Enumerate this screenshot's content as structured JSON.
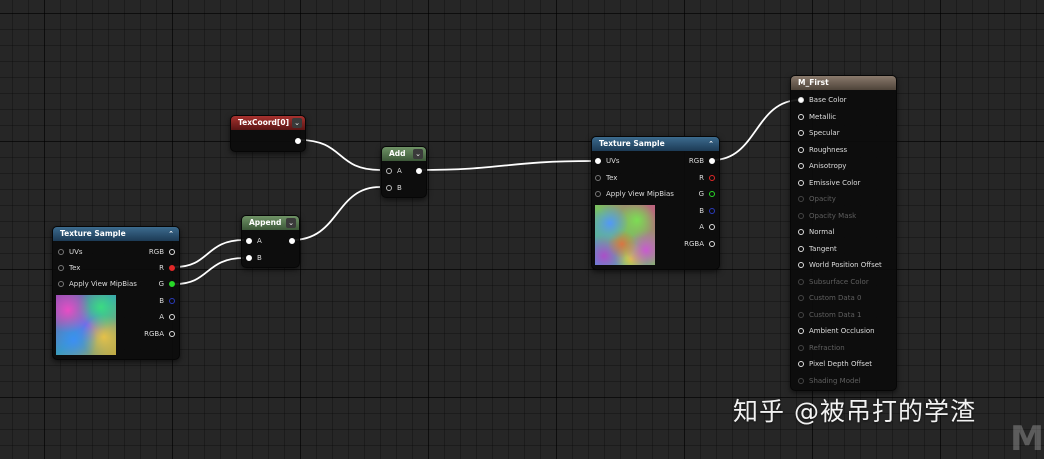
{
  "nodes": {
    "texcoord": {
      "title": "TexCoord[0]"
    },
    "add": {
      "title": "Add",
      "inputs": [
        "A",
        "B"
      ]
    },
    "append": {
      "title": "Append",
      "inputs": [
        "A",
        "B"
      ]
    },
    "texture_sample_left": {
      "title": "Texture Sample",
      "inputs": [
        "UVs",
        "Tex",
        "Apply View MipBias"
      ],
      "outputs": [
        "RGB",
        "R",
        "G",
        "B",
        "A",
        "RGBA"
      ]
    },
    "texture_sample_right": {
      "title": "Texture Sample",
      "inputs": [
        "UVs",
        "Tex",
        "Apply View MipBias"
      ],
      "outputs": [
        "RGB",
        "R",
        "G",
        "B",
        "A",
        "RGBA"
      ]
    },
    "material": {
      "title": "M_First",
      "pins": [
        {
          "label": "Base Color",
          "active": true
        },
        {
          "label": "Metallic",
          "active": true
        },
        {
          "label": "Specular",
          "active": true
        },
        {
          "label": "Roughness",
          "active": true
        },
        {
          "label": "Anisotropy",
          "active": true
        },
        {
          "label": "Emissive Color",
          "active": true
        },
        {
          "label": "Opacity",
          "active": false
        },
        {
          "label": "Opacity Mask",
          "active": false
        },
        {
          "label": "Normal",
          "active": true
        },
        {
          "label": "Tangent",
          "active": true
        },
        {
          "label": "World Position Offset",
          "active": true
        },
        {
          "label": "Subsurface Color",
          "active": false
        },
        {
          "label": "Custom Data 0",
          "active": false
        },
        {
          "label": "Custom Data 1",
          "active": false
        },
        {
          "label": "Ambient Occlusion",
          "active": true
        },
        {
          "label": "Refraction",
          "active": false
        },
        {
          "label": "Pixel Depth Offset",
          "active": true
        },
        {
          "label": "Shading Model",
          "active": false
        }
      ]
    }
  },
  "icons": {
    "collapse": "chevron-up-icon",
    "dropdown": "chevron-down-icon",
    "collapse_glyph": "⌃",
    "dropdown_glyph": "⌄"
  },
  "colors": {
    "wire": "#ffffff",
    "pin_r": "#e02828",
    "pin_g": "#28d828",
    "pin_b": "#2b3bbd"
  },
  "watermark": "知乎 @被吊打的学渣",
  "corner_mark": "M"
}
